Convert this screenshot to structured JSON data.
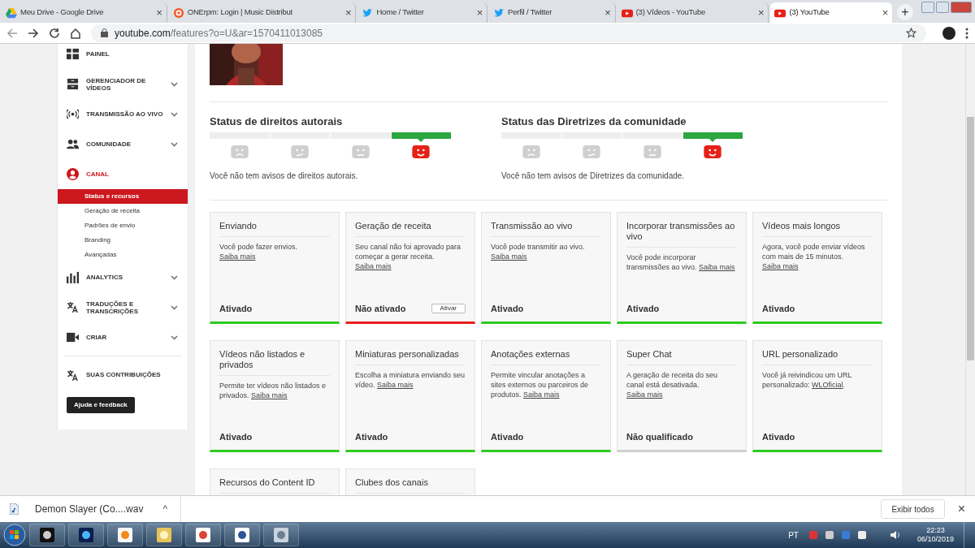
{
  "browser": {
    "tabs": [
      {
        "kind": "drive",
        "title": "Meu Drive - Google Drive",
        "selected": false
      },
      {
        "kind": "onerpm",
        "title": "ONErpm: Login | Music Distribut",
        "selected": false
      },
      {
        "kind": "twitter",
        "title": "Home / Twitter",
        "selected": false
      },
      {
        "kind": "twitter",
        "title": "Perfil / Twitter",
        "selected": false
      },
      {
        "kind": "youtube",
        "title": "(3) Vídeos - YouTube",
        "selected": false
      },
      {
        "kind": "youtube",
        "title": "(3) YouTube",
        "selected": true
      }
    ],
    "tab_close": "×",
    "new_tab": "+",
    "address": {
      "domain": "youtube.com",
      "path": "/features?o=U&ar=1570411013085"
    }
  },
  "sidebar": {
    "items": [
      {
        "kind": "dashboard",
        "label": "PAINEL",
        "expandable": false,
        "selected": false
      },
      {
        "kind": "videos",
        "label": "GERENCIADOR DE VÍDEOS",
        "expandable": true,
        "selected": false
      },
      {
        "kind": "live",
        "label": "TRANSMISSÃO AO VIVO",
        "expandable": true,
        "selected": false
      },
      {
        "kind": "community",
        "label": "COMUNIDADE",
        "expandable": true,
        "selected": false
      },
      {
        "kind": "channel",
        "label": "CANAL",
        "expandable": false,
        "selected": true,
        "children": [
          {
            "label": "Status e recursos",
            "selected": true
          },
          {
            "label": "Geração de receita",
            "selected": false
          },
          {
            "label": "Padrões de envio",
            "selected": false
          },
          {
            "label": "Branding",
            "selected": false
          },
          {
            "label": "Avançadas",
            "selected": false
          }
        ]
      },
      {
        "kind": "analytics",
        "label": "ANALYTICS",
        "expandable": true,
        "selected": false
      },
      {
        "kind": "translate",
        "label": "TRADUÇÕES E TRANSCRIÇÕES",
        "expandable": true,
        "selected": false
      },
      {
        "kind": "create",
        "label": "CRIAR",
        "expandable": true,
        "selected": false
      }
    ],
    "contributions": {
      "kind": "translate",
      "label": "SUAS CONTRIBUIÇÕES"
    },
    "help_button": "Ajuda e feedback"
  },
  "status": [
    {
      "title": "Status de direitos autorais",
      "strikes": [
        {
          "kind": "sad",
          "selected": false
        },
        {
          "kind": "meh",
          "selected": false
        },
        {
          "kind": "neutral",
          "selected": false
        },
        {
          "kind": "happy",
          "selected": true
        }
      ],
      "message": "Você não tem avisos de direitos autorais."
    },
    {
      "title": "Status das Diretrizes da comunidade",
      "strikes": [
        {
          "kind": "sad",
          "selected": false
        },
        {
          "kind": "meh",
          "selected": false
        },
        {
          "kind": "neutral",
          "selected": false
        },
        {
          "kind": "happy",
          "selected": true
        }
      ],
      "message": "Você não tem avisos de Diretrizes da comunidade."
    }
  ],
  "features": [
    {
      "title": "Enviando",
      "text": "Você pode fazer envios. ",
      "link": "Saiba mais",
      "status": "Ativado",
      "color": "#2ecc1f"
    },
    {
      "title": "Geração de receita",
      "text": "Seu canal não foi aprovado para começar a gerar receita. ",
      "link": "Saiba mais",
      "status": "Não ativado",
      "button": "Ativar",
      "color": "#e52020"
    },
    {
      "title": "Transmissão ao vivo",
      "text": "Você pode transmitir ao vivo. ",
      "link": "Saiba mais",
      "status": "Ativado",
      "color": "#2ecc1f"
    },
    {
      "title": "Incorporar transmissões ao vivo",
      "text": "Você pode incorporar transmissões ao vivo. ",
      "link": "Saiba mais",
      "status": "Ativado",
      "color": "#2ecc1f"
    },
    {
      "title": "Vídeos mais longos",
      "text": "Agora, você pode enviar vídeos com mais de 15 minutos. ",
      "link": "Saiba mais",
      "status": "Ativado",
      "color": "#2ecc1f"
    },
    {
      "title": "Vídeos não listados e privados",
      "text": "Permite ter vídeos não listados e privados. ",
      "link": "Saiba mais",
      "status": "Ativado",
      "color": "#2ecc1f"
    },
    {
      "title": "Miniaturas personalizadas",
      "text": "Escolha a miniatura enviando seu vídeo. ",
      "link": "Saiba mais",
      "status": "Ativado",
      "color": "#2ecc1f"
    },
    {
      "title": "Anotações externas",
      "text": "Permite vincular anotações a sites externos ou parceiros de produtos. ",
      "link": "Saiba mais",
      "status": "Ativado",
      "color": "#2ecc1f"
    },
    {
      "title": "Super Chat",
      "text": "A geração de receita do seu canal está desativada. ",
      "link": "Saiba mais",
      "status": "Não qualificado",
      "color": "#d0d0d0"
    },
    {
      "title": "URL personalizado",
      "text": "Você já reivindicou um URL personalizado: ",
      "link": "WLOficial",
      "after": ".",
      "status": "Ativado",
      "color": "#2ecc1f"
    },
    {
      "title": "Recursos do Content ID"
    },
    {
      "title": "Clubes dos canais"
    }
  ],
  "download_bar": {
    "file": "Demon Slayer (Co....wav",
    "chevron": "^",
    "show_all": "Exibir todos",
    "close": "×"
  },
  "taskbar": {
    "apps": [
      {
        "kind": "xsplit"
      },
      {
        "kind": "photoshop"
      },
      {
        "kind": "media"
      },
      {
        "kind": "explorer"
      },
      {
        "kind": "chrome"
      },
      {
        "kind": "word"
      },
      {
        "kind": "calculator"
      }
    ],
    "language": "PT",
    "time": "22:23",
    "date": "06/10/2019"
  }
}
